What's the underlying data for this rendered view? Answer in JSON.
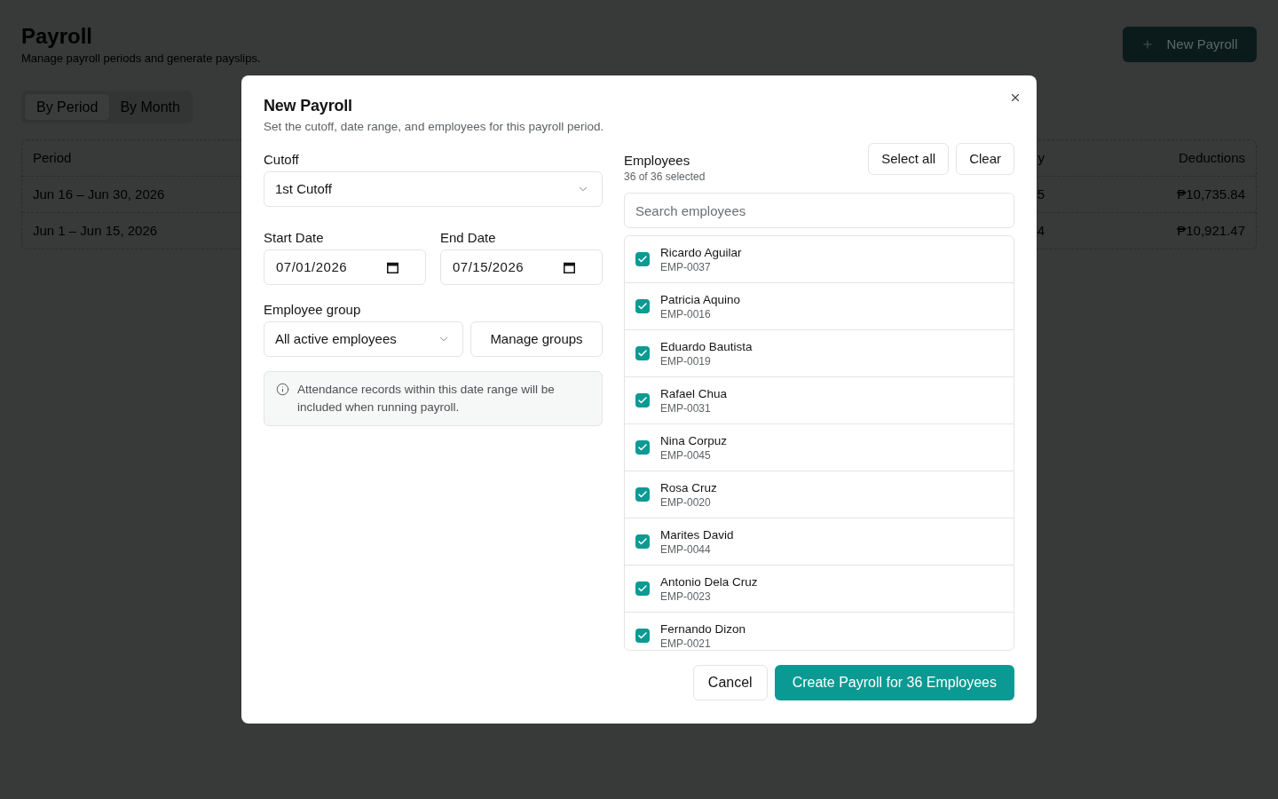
{
  "page": {
    "title": "Payroll",
    "subtitle": "Manage payroll periods and generate payslips.",
    "new_button": {
      "label": "New Payroll"
    }
  },
  "tabs": [
    {
      "label": "By Period",
      "selected": true
    },
    {
      "label": "By Month",
      "selected": false
    }
  ],
  "table": {
    "columns": [
      "Period",
      "y",
      "Deductions"
    ],
    "rows": [
      [
        "Jun 16 – Jun 30, 2026",
        "5",
        "₱10,735.84"
      ],
      [
        "Jun 1 – Jun 15, 2026",
        "4",
        "₱10,921.47"
      ]
    ]
  },
  "dialog": {
    "title": "New Payroll",
    "description": "Set the cutoff, date range, and employees for this payroll period.",
    "cutoff": {
      "label": "Cutoff",
      "value": "1st Cutoff"
    },
    "dates": [
      {
        "label": "Start Date",
        "value": "07/01/2026"
      },
      {
        "label": "End Date",
        "value": "07/15/2026"
      }
    ],
    "employee_group": {
      "label": "Employee group",
      "value": "All active employees",
      "button": "Manage groups"
    },
    "info": "Attendance records within this date range will be included when running payroll.",
    "employees": {
      "label": "Employees",
      "count": "36 of 36 selected",
      "actions": [
        "Select all",
        "Clear"
      ],
      "search": {
        "placeholder": "Search employees"
      },
      "items": [
        {
          "name": "Ricardo Aguilar",
          "employee_no": "EMP-0037",
          "checked": true
        },
        {
          "name": "Patricia Aquino",
          "employee_no": "EMP-0016",
          "checked": true
        },
        {
          "name": "Eduardo Bautista",
          "employee_no": "EMP-0019",
          "checked": true
        },
        {
          "name": "Rafael Chua",
          "employee_no": "EMP-0031",
          "checked": true
        },
        {
          "name": "Nina Corpuz",
          "employee_no": "EMP-0045",
          "checked": true
        },
        {
          "name": "Rosa Cruz",
          "employee_no": "EMP-0020",
          "checked": true
        },
        {
          "name": "Marites David",
          "employee_no": "EMP-0044",
          "checked": true
        },
        {
          "name": "Antonio Dela Cruz",
          "employee_no": "EMP-0023",
          "checked": true
        },
        {
          "name": "Fernando Dizon",
          "employee_no": "EMP-0021",
          "checked": true
        }
      ]
    },
    "buttons": [
      {
        "label": "Cancel",
        "kind": "secondary"
      },
      {
        "label": "Create Payroll for 36 Employees",
        "kind": "primary"
      }
    ]
  }
}
